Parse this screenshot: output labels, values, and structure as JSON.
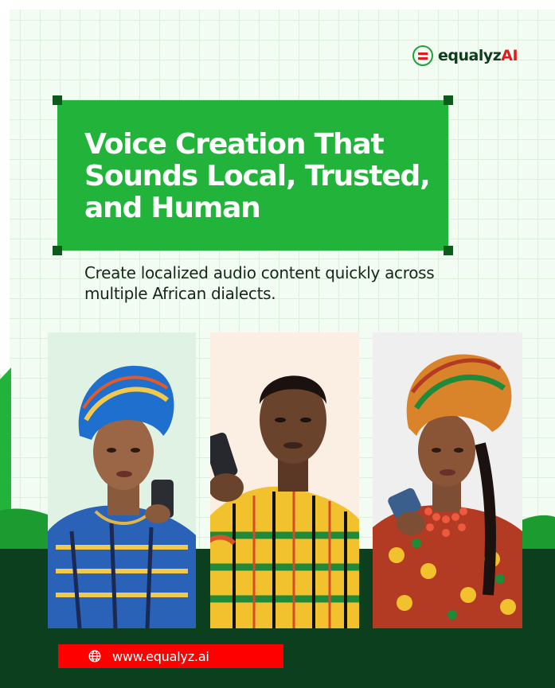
{
  "brand": {
    "name_main": "equalyz",
    "name_accent": "AI"
  },
  "headline": "Voice Creation That Sounds Local, Trusted, and Human",
  "subtitle": "Create localized audio content quickly across multiple African dialects.",
  "website": {
    "url": "www.equalyz.ai",
    "icon": "globe-icon"
  },
  "photos": [
    {
      "subject": "woman in blue head wrap holding phone"
    },
    {
      "subject": "man in kente cloth speaking into phone"
    },
    {
      "subject": "woman in patterned gele with coral beads holding phone"
    }
  ],
  "colors": {
    "primary_green": "#22b33a",
    "dark_green": "#0c3f1d",
    "accent_red": "#ff0000",
    "background": "#f3fcf2"
  }
}
